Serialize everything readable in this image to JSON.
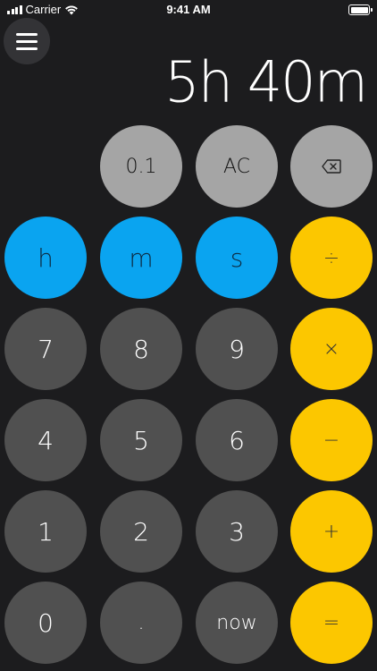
{
  "status_bar": {
    "carrier": "Carrier",
    "time": "9:41 AM"
  },
  "display": {
    "value": "5h 40m"
  },
  "keys": {
    "decimal_tenth": "0.1",
    "clear": "AC",
    "backspace_icon": "backspace-icon",
    "hours": "h",
    "minutes": "m",
    "seconds": "s",
    "divide": "÷",
    "seven": "7",
    "eight": "8",
    "nine": "9",
    "multiply": "×",
    "four": "4",
    "five": "5",
    "six": "6",
    "minus": "−",
    "one": "1",
    "two": "2",
    "three": "3",
    "plus": "+",
    "zero": "0",
    "point": ".",
    "now": "now",
    "equals": "="
  },
  "colors": {
    "background": "#1c1c1e",
    "function_key": "#a5a5a5",
    "unit_key": "#0aa4f0",
    "operator_key": "#fcc700",
    "digit_key": "#505050"
  }
}
